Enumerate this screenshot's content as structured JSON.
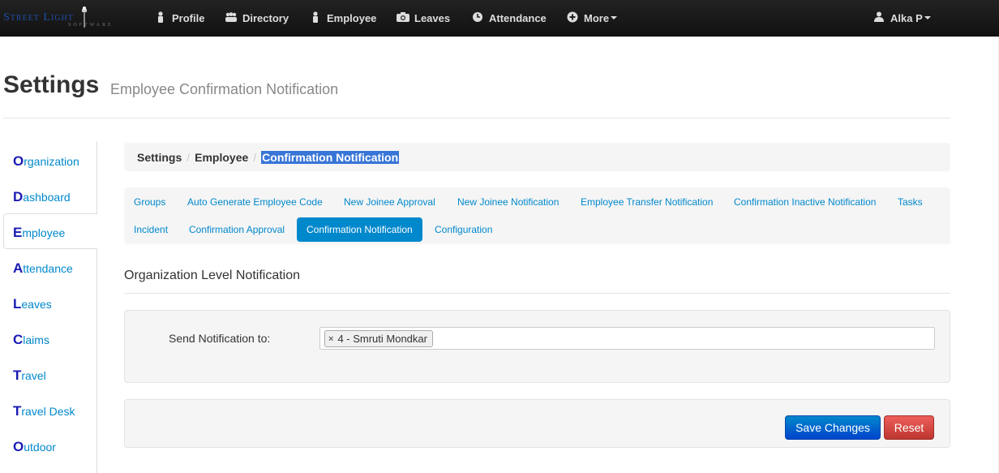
{
  "brand": {
    "name": "Street Light",
    "sub": "SOFTWARE"
  },
  "nav": {
    "items": [
      {
        "label": "Profile",
        "icon": "user-icon"
      },
      {
        "label": "Directory",
        "icon": "group-icon"
      },
      {
        "label": "Employee",
        "icon": "user-icon"
      },
      {
        "label": "Leaves",
        "icon": "camera-icon"
      },
      {
        "label": "Attendance",
        "icon": "clock-icon"
      },
      {
        "label": "More",
        "icon": "plus-circle-icon"
      }
    ],
    "user": "Alka P"
  },
  "header": {
    "title": "Settings",
    "subtitle": "Employee Confirmation Notification"
  },
  "sidebar": {
    "items": [
      {
        "first": "O",
        "rest": "rganization"
      },
      {
        "first": "D",
        "rest": "ashboard"
      },
      {
        "first": "E",
        "rest": "mployee"
      },
      {
        "first": "A",
        "rest": "ttendance"
      },
      {
        "first": "L",
        "rest": "eaves"
      },
      {
        "first": "C",
        "rest": "laims"
      },
      {
        "first": "T",
        "rest": "ravel"
      },
      {
        "first": "T",
        "rest": "ravel Desk"
      },
      {
        "first": "O",
        "rest": "utdoor"
      }
    ],
    "active_index": 2
  },
  "breadcrumb": {
    "items": [
      "Settings",
      "Employee"
    ],
    "active": "Confirmation Notification"
  },
  "tabs": {
    "row1": [
      "Groups",
      "Auto Generate Employee Code",
      "New Joinee Approval",
      "New Joinee Notification",
      "Employee Transfer Notification",
      "Confirmation Inactive Notification",
      "Tasks"
    ],
    "row2": [
      "Incident",
      "Confirmation Approval",
      "Confirmation Notification",
      "Configuration"
    ],
    "active": "Confirmation Notification"
  },
  "section": {
    "title": "Organization Level Notification"
  },
  "form": {
    "label": "Send Notification to:",
    "selected": [
      "4 - Smruti Mondkar"
    ],
    "remove_symbol": "×"
  },
  "actions": {
    "save": "Save Changes",
    "reset": "Reset"
  },
  "colors": {
    "accent": "#0088cc",
    "danger": "#bd362f",
    "navbar": "#1b1b1b"
  }
}
